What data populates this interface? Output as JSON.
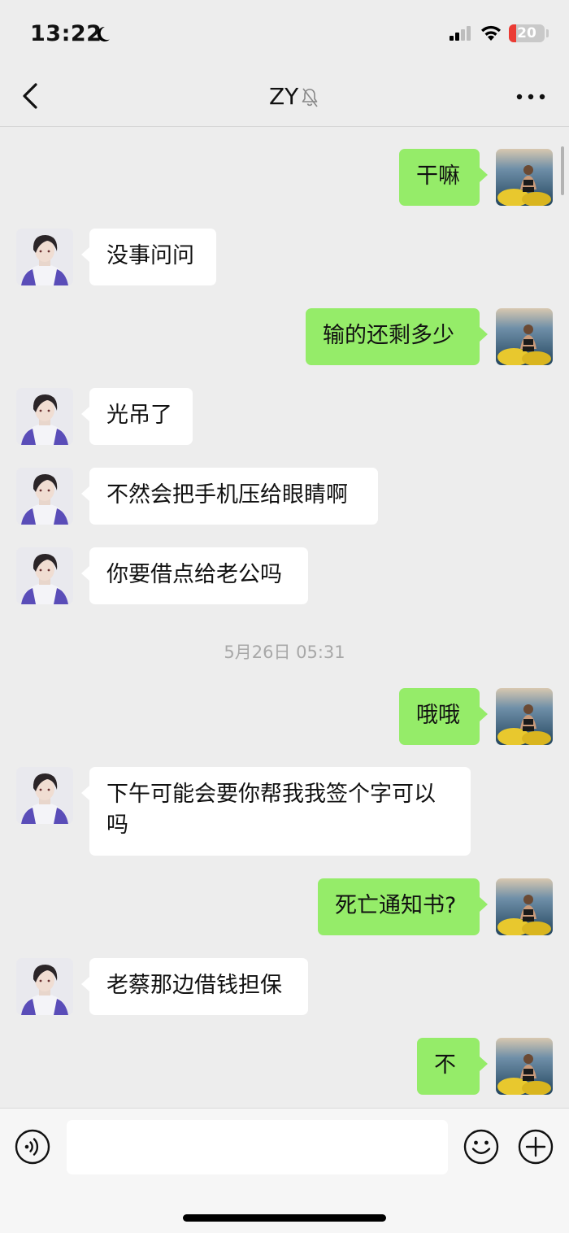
{
  "status_bar": {
    "time": "13:22",
    "battery": "20",
    "battery_level": 0.2
  },
  "nav": {
    "title": "ZY"
  },
  "chat": {
    "messages": [
      {
        "side": "out",
        "text": "干嘛"
      },
      {
        "side": "in",
        "text": "没事问问"
      },
      {
        "side": "out",
        "text": "输的还剩多少"
      },
      {
        "side": "in",
        "text": "光吊了"
      },
      {
        "side": "in",
        "text": "不然会把手机压给眼睛啊"
      },
      {
        "side": "in",
        "text": "你要借点给老公吗"
      },
      {
        "timestamp": "5月26日 05:31"
      },
      {
        "side": "out",
        "text": "哦哦"
      },
      {
        "side": "in",
        "text": "下午可能会要你帮我我签个字可以吗"
      },
      {
        "side": "out",
        "text": "死亡通知书?"
      },
      {
        "side": "in",
        "text": "老蔡那边借钱担保"
      },
      {
        "side": "out",
        "text": "不"
      }
    ]
  },
  "input": {
    "value": ""
  },
  "colors": {
    "sent_bubble": "#95ec69",
    "received_bubble": "#ffffff",
    "background": "#ededed"
  },
  "icons": [
    "moon-icon",
    "signal-icon",
    "wifi-icon",
    "battery-icon",
    "back-icon",
    "mute-bell-icon",
    "more-icon",
    "voice-icon",
    "emoji-icon",
    "plus-icon"
  ]
}
